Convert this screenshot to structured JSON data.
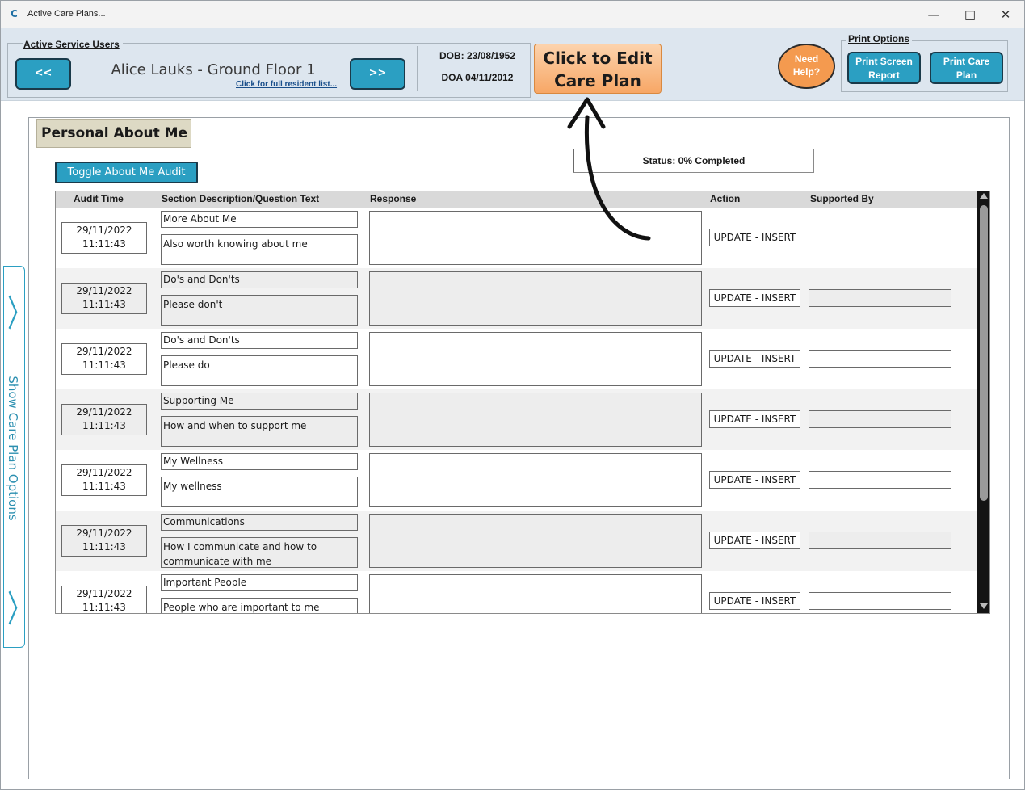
{
  "window": {
    "title": "Active Care Plans...",
    "minimize": "—",
    "maximize": "□",
    "close": "✕"
  },
  "header": {
    "group_label": "Active Service Users",
    "prev_label": "<<",
    "next_label": ">>",
    "resident_name": "Alice Lauks - Ground Floor 1",
    "resident_link": "Click for full resident list...",
    "dob": "DOB: 23/08/1952",
    "doa": "DOA 04/11/2012",
    "edit_line1": "Click to Edit",
    "edit_line2": "Care Plan",
    "help_line1": "Need",
    "help_line2": "Help?",
    "print_group_label": "Print Options",
    "print_screen_line1": "Print Screen",
    "print_screen_line2": "Report",
    "print_care_line1": "Print Care",
    "print_care_line2": "Plan"
  },
  "main": {
    "section_title": "Personal About Me",
    "toggle_audit": "Toggle About Me Audit",
    "status": "Status: 0% Completed",
    "columns": {
      "audit_time": "Audit Time",
      "section": "Section Description/Question Text",
      "response": "Response",
      "action": "Action",
      "supported_by": "Supported By"
    },
    "rows": [
      {
        "date": "29/11/2022",
        "time": "11:11:43",
        "section": "More About Me",
        "question": "Also worth knowing about me",
        "action": "UPDATE - INSERT"
      },
      {
        "date": "29/11/2022",
        "time": "11:11:43",
        "section": "Do's and Don'ts",
        "question": "Please don't",
        "action": "UPDATE - INSERT"
      },
      {
        "date": "29/11/2022",
        "time": "11:11:43",
        "section": "Do's and Don'ts",
        "question": "Please do",
        "action": "UPDATE - INSERT"
      },
      {
        "date": "29/11/2022",
        "time": "11:11:43",
        "section": "Supporting Me",
        "question": "How and when to support me",
        "action": "UPDATE - INSERT"
      },
      {
        "date": "29/11/2022",
        "time": "11:11:43",
        "section": "My Wellness",
        "question": "My wellness",
        "action": "UPDATE - INSERT"
      },
      {
        "date": "29/11/2022",
        "time": "11:11:43",
        "section": "Communications",
        "question": "How I communicate and how to communicate with me",
        "action": "UPDATE - INSERT"
      },
      {
        "date": "29/11/2022",
        "time": "11:11:43",
        "section": "Important People",
        "question": "People who are important to me",
        "action": "UPDATE - INSERT"
      }
    ]
  },
  "side_panel": {
    "label": "Show Care Plan Options",
    "chevron": "〉"
  },
  "icons": {
    "app_icon": "C",
    "scroll_up": "triangle-up",
    "scroll_down": "triangle-down",
    "annotation_arrow": "curved-arrow-up"
  },
  "colors": {
    "accent_button": "#2b9fc2",
    "edit_button": "#f7a766",
    "help_button": "#f49a4f",
    "header_band": "#dde6ef",
    "section_title_bg": "#ddd9c4"
  }
}
